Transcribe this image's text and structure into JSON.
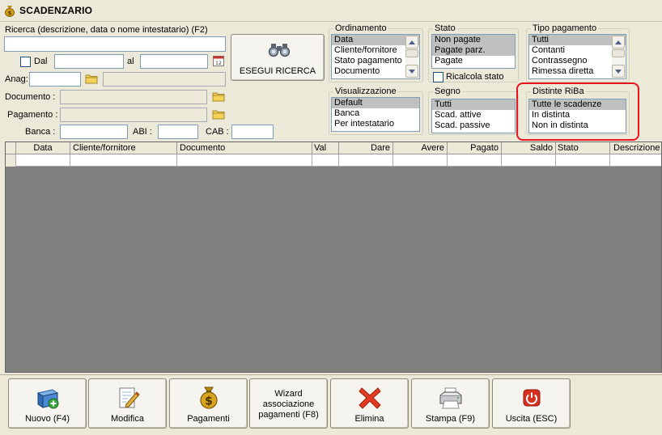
{
  "window": {
    "title": "SCADENZARIO"
  },
  "search": {
    "label": "Ricerca (descrizione, data o nome intestatario) (F2)",
    "value": "",
    "dal_label": "Dal",
    "al_label": "al",
    "anag_label": "Anag:",
    "documento_label": "Documento :",
    "pagamento_label": "Pagamento :",
    "banca_label": "Banca :",
    "abi_label": "ABI :",
    "cab_label": "CAB :",
    "button_label": "ESEGUI RICERCA"
  },
  "ordinamento": {
    "title": "Ordinamento",
    "items": [
      "Data",
      "Cliente/fornitore",
      "Stato pagamento",
      "Documento"
    ],
    "selected": 0
  },
  "stato": {
    "title": "Stato",
    "items": [
      "Non pagate",
      "Pagate parz.",
      "Pagate"
    ],
    "selected": [
      0,
      1
    ],
    "ricalcola_label": "Ricalcola stato"
  },
  "tipo_pagamento": {
    "title": "Tipo pagamento",
    "items": [
      "Tutti",
      "Contanti",
      "Contrassegno",
      "Rimessa diretta"
    ],
    "selected": 0
  },
  "visualizzazione": {
    "title": "Visualizzazione",
    "items": [
      "Default",
      "Banca",
      "Per intestatario"
    ],
    "selected": 0
  },
  "segno": {
    "title": "Segno",
    "items": [
      "Tutti",
      "Scad. attive",
      "Scad. passive"
    ],
    "selected": 0
  },
  "distinte_riba": {
    "title": "Distinte RiBa",
    "items": [
      "Tutte le scadenze",
      "In distinta",
      "Non in distinta"
    ],
    "selected": 0
  },
  "grid": {
    "columns": [
      "Data",
      "Cliente/fornitore",
      "Documento",
      "Val",
      "Dare",
      "Avere",
      "Pagato",
      "Saldo",
      "Stato",
      "Descrizione"
    ]
  },
  "toolbar": {
    "nuovo": "Nuovo (F4)",
    "modifica": "Modifica",
    "pagamenti": "Pagamenti",
    "wizard": "Wizard associazione pagamenti (F8)",
    "elimina": "Elimina",
    "stampa": "Stampa (F9)",
    "uscita": "Uscita (ESC)"
  },
  "colors": {
    "highlight_frame": "#e8141e",
    "selection": "#c0c0c0",
    "grid_background": "#808080"
  }
}
